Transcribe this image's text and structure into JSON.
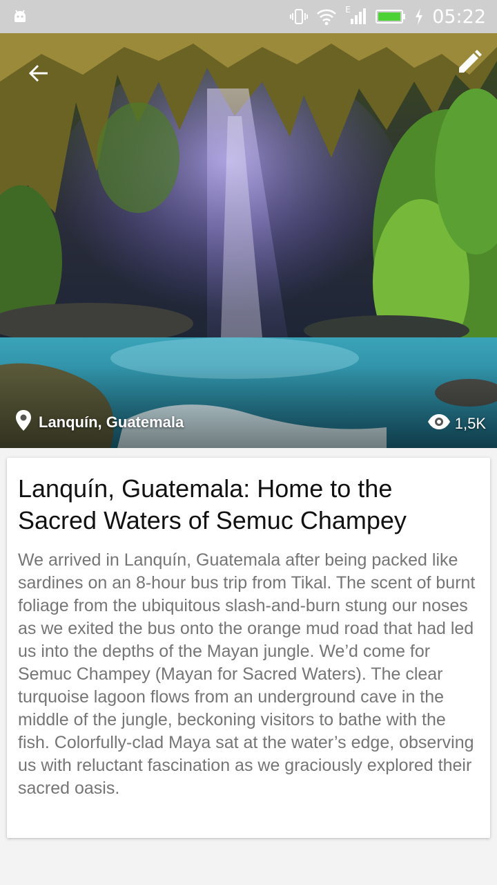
{
  "status_bar": {
    "time": "05:22",
    "icons": [
      "android-icon",
      "vibrate-icon",
      "wifi-icon",
      "signal-icon",
      "battery-icon",
      "charging-icon"
    ],
    "network_label": "E"
  },
  "header": {
    "back_icon": "arrow-left-icon",
    "edit_icon": "pencil-icon"
  },
  "hero": {
    "location": "Lanquín, Guatemala",
    "location_icon": "map-pin-icon",
    "views": "1,5K",
    "views_icon": "eye-icon"
  },
  "article": {
    "title": "Lanquín, Guatemala: Home to the Sacred Waters of Semuc Champey",
    "body": "We arrived in Lanquín, Guatemala after being packed like sardines on an 8-hour bus trip from Tikal. The scent of burnt foliage from the ubiquitous slash-and-burn stung our noses as we exited the bus onto the orange mud road that had led us into the depths of the Mayan jungle. We’d come for Semuc Champey (Mayan for Sacred Waters). The clear turquoise lagoon flows from an underground cave in the middle of the jungle, beckoning visitors to bathe with the fish. Colorfully-clad Maya sat at the water’s edge, observing us with reluctant fascination as we graciously explored their sacred oasis."
  },
  "colors": {
    "status_bar": "#cfcfcf",
    "battery": "#4cd137",
    "page_background": "#f3f3f3",
    "title_text": "#111111",
    "body_text": "#757575"
  }
}
